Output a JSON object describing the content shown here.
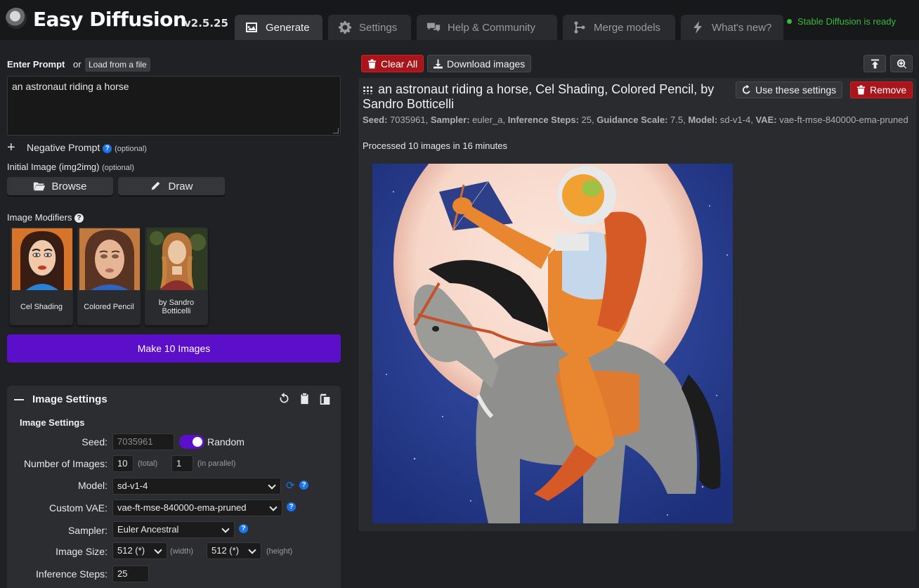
{
  "app": {
    "title": "Easy Diffusion",
    "version": "v2.5.25",
    "status": "Stable Diffusion is ready"
  },
  "tabs": [
    {
      "label": "Generate",
      "icon": "image-icon"
    },
    {
      "label": "Settings",
      "icon": "gear-icon"
    },
    {
      "label": "Help & Community",
      "icon": "comments-icon"
    },
    {
      "label": "Merge models",
      "icon": "merge-icon"
    },
    {
      "label": "What's new?",
      "icon": "bolt-icon"
    }
  ],
  "prompt": {
    "label": "Enter Prompt",
    "or": "or",
    "load_button": "Load from a file",
    "value": "an astronaut riding a horse"
  },
  "negative_prompt": {
    "label": "Negative Prompt",
    "optional": "(optional)"
  },
  "init_image": {
    "label": "Initial Image (img2img)",
    "optional": "(optional)",
    "browse": "Browse",
    "draw": "Draw"
  },
  "modifiers": {
    "label": "Image Modifiers",
    "items": [
      "Cel Shading",
      "Colored Pencil",
      "by Sandro Botticelli"
    ]
  },
  "make_button": "Make 10 Images",
  "image_settings": {
    "panel_title": "Image Settings",
    "section_title": "Image Settings",
    "seed_label": "Seed:",
    "seed_value": "7035961",
    "random_label": "Random",
    "num_images_label": "Number of Images:",
    "num_total": "10",
    "total_hint": "(total)",
    "num_parallel": "1",
    "parallel_hint": "(in parallel)",
    "model_label": "Model:",
    "model_value": "sd-v1-4",
    "vae_label": "Custom VAE:",
    "vae_value": "vae-ft-mse-840000-ema-pruned",
    "sampler_label": "Sampler:",
    "sampler_value": "Euler Ancestral",
    "size_label": "Image Size:",
    "width_value": "512 (*)",
    "width_hint": "(width)",
    "height_value": "512 (*)",
    "height_hint": "(height)",
    "steps_label": "Inference Steps:",
    "steps_value": "25"
  },
  "toolbar": {
    "clear_all": "Clear All",
    "download": "Download images"
  },
  "result": {
    "title": "an astronaut riding a horse, Cel Shading, Colored Pencil, by Sandro Botticelli",
    "use_settings": "Use these settings",
    "remove": "Remove",
    "seed_key": "Seed:",
    "seed": "7035961",
    "sampler_key": "Sampler:",
    "sampler": "euler_a",
    "steps_key": "Inference Steps:",
    "steps": "25",
    "guidance_key": "Guidance Scale:",
    "guidance": "7.5",
    "model_key": "Model:",
    "model": "sd-v1-4",
    "vae_key": "VAE:",
    "vae": "vae-ft-mse-840000-ema-pruned",
    "processed": "Processed 10 images in 16 minutes"
  },
  "colors": {
    "accent": "#5b0fc8",
    "danger": "#a8161c",
    "status": "#3ab83a",
    "help": "#1a73e8"
  }
}
